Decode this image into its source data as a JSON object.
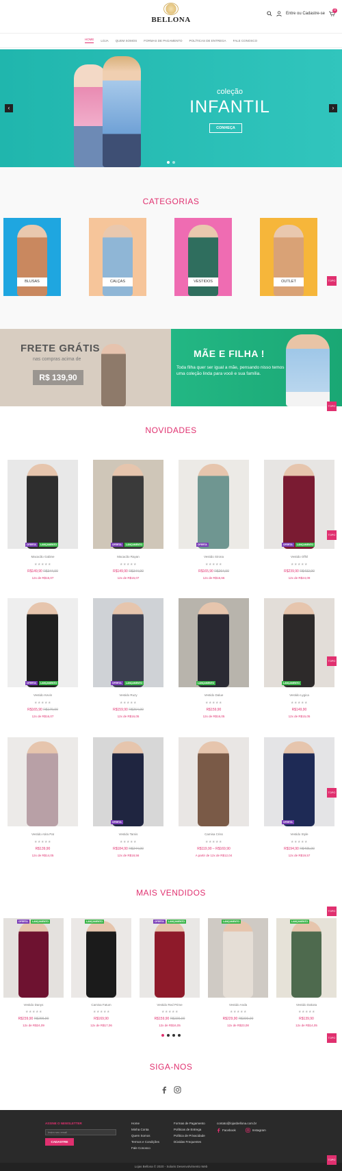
{
  "header": {
    "brand": "BELLONA",
    "account_label": "Entre ou Cadastre-se",
    "cart_count": "0"
  },
  "nav": [
    "HOME",
    "LOJA",
    "QUEM SOMOS",
    "FORMAS DE PAGAMENTO",
    "POLÍTICAS DE ENTREGA",
    "FALE CONOSCO"
  ],
  "hero": {
    "subtitle": "coleção",
    "title": "INFANTIL",
    "button": "CONHEÇA",
    "prev": "‹",
    "next": "›"
  },
  "categories": {
    "title": "CATEGORIAS",
    "items": [
      {
        "label": "BLUSAS",
        "bg": "#1fa6e0",
        "fig": "#c9885f"
      },
      {
        "label": "CALÇAS",
        "bg": "#f6c59a",
        "fig": "#8fb6d6"
      },
      {
        "label": "VESTIDOS",
        "bg": "#ef6cb2",
        "fig": "#2f6e5e"
      },
      {
        "label": "OUTLET",
        "bg": "#f6b63a",
        "fig": "#d9a276"
      }
    ]
  },
  "topo_label": "TOPO",
  "banners": {
    "frete_title": "FRETE GRÁTIS",
    "frete_sub": "nas compras acima de",
    "frete_price": "R$ 139,90",
    "mae_title": "MÃE E FILHA !",
    "mae_text": "Toda filha quer ser igual a mãe, pensando nisso temos uma coleção linda para você e sua família."
  },
  "novidades": {
    "title": "NOVIDADES",
    "products": [
      {
        "name": "Macacão Gabine",
        "price": "R$149,90",
        "old": "R$344,90",
        "inst": "12x de R$15,07",
        "tags": [
          "OFERTA",
          "LANÇAMENTO"
        ],
        "bg": "#e8e8e8",
        "fig": "#2e2e2e"
      },
      {
        "name": "Macacão Rayan",
        "price": "R$149,90",
        "old": "R$344,90",
        "inst": "12x de R$15,07",
        "tags": [
          "OFERTA",
          "LANÇAMENTO"
        ],
        "bg": "#cfc6b8",
        "fig": "#3a3a3a"
      },
      {
        "name": "Vestido Sirona",
        "price": "R$165,90",
        "old": "R$264,90",
        "inst": "12x de R$16,66",
        "tags": [
          "OFERTA"
        ],
        "bg": "#eceae6",
        "fig": "#6f9691"
      },
      {
        "name": "Vestido Ofhil",
        "price": "R$239,90",
        "old": "R$432,90",
        "inst": "12x de R$24,09",
        "tags": [
          "OFERTA",
          "LANÇAMENTO"
        ],
        "bg": "#e7e5e3",
        "fig": "#7a1b32"
      },
      {
        "name": "Vestido Kevin",
        "price": "R$165,90",
        "old": "R$179,90",
        "inst": "12x de R$16,07",
        "tags": [
          "OFERTA",
          "LANÇAMENTO"
        ],
        "bg": "#eeeeee",
        "fig": "#1f1f1f"
      },
      {
        "name": "Vestido Ruzy",
        "price": "R$159,90",
        "old": "R$264,90",
        "inst": "12x de R$16,05",
        "tags": [
          "OFERTA",
          "LANÇAMENTO"
        ],
        "bg": "#cfd2d6",
        "fig": "#3b3f4f"
      },
      {
        "name": "Vestido Dalue",
        "price": "R$159,90",
        "old": "",
        "inst": "12x de R$16,05",
        "tags": [
          "LANÇAMENTO"
        ],
        "bg": "#b8b4ac",
        "fig": "#2a2a33"
      },
      {
        "name": "Vestido Lygica",
        "price": "R$149,90",
        "old": "",
        "inst": "12x de R$15,05",
        "tags": [
          "LANÇAMENTO"
        ],
        "bg": "#e2ddd8",
        "fig": "#2d2a2a"
      },
      {
        "name": "Vestido Atira Pat",
        "price": "R$139,90",
        "old": "",
        "inst": "12x de R$14,05",
        "tags": [],
        "bg": "#eceae8",
        "fig": "#b8a0a6"
      },
      {
        "name": "Vestido Tamis",
        "price": "R$184,90",
        "old": "R$244,90",
        "inst": "12x de R$18,56",
        "tags": [
          "OFERTA"
        ],
        "bg": "#d7d7d7",
        "fig": "#1f2540"
      },
      {
        "name": "Camisa Criss",
        "price": "R$119,90 – R$169,90",
        "old": "",
        "inst": "A partir de 12x de R$12,04",
        "tags": [],
        "bg": "#e9e6e4",
        "fig": "#7a5a47"
      },
      {
        "name": "Vestido Style",
        "price": "R$194,90",
        "old": "R$405,90",
        "inst": "12x de R$19,57",
        "tags": [
          "OFERTA"
        ],
        "bg": "#e4e4e6",
        "fig": "#1e2a55"
      }
    ]
  },
  "mais_vendidos": {
    "title": "MAIS VENDIDOS",
    "products": [
      {
        "name": "Vestido Danys",
        "price": "R$239,90",
        "old": "R$299,90",
        "inst": "12x de R$24,09",
        "tags": [
          "OFERTA",
          "LANÇAMENTO"
        ],
        "bg": "#e4e1de",
        "fig": "#6e1230"
      },
      {
        "name": "Camisa Fatum",
        "price": "R$169,90",
        "old": "",
        "inst": "12x de R$17,06",
        "tags": [
          "LANÇAMENTO"
        ],
        "bg": "#ebe8e6",
        "fig": "#1b1b1b"
      },
      {
        "name": "Vestido Red Prime",
        "price": "R$159,90",
        "old": "R$220,00",
        "inst": "12x de R$16,05",
        "tags": [
          "OFERTA",
          "LANÇAMENTO"
        ],
        "bg": "#e9e7e5",
        "fig": "#8e1a2a"
      },
      {
        "name": "Vestido Anda",
        "price": "R$229,90",
        "old": "R$300,00",
        "inst": "12x de R$23,08",
        "tags": [
          "LANÇAMENTO"
        ],
        "bg": "#cfcac4",
        "fig": "#e5ded6"
      },
      {
        "name": "Vestido Dakota",
        "price": "R$139,90",
        "old": "",
        "inst": "12x de R$14,05",
        "tags": [
          "LANÇAMENTO"
        ],
        "bg": "#e6e2d8",
        "fig": "#4e6a4e"
      }
    ]
  },
  "stars": "★★★★★",
  "siga": {
    "title": "SIGA-NOS"
  },
  "footer": {
    "newsletter_title": "ASSINE O NEWSLETTER",
    "newsletter_placeholder": "Insira seu email",
    "newsletter_button": "CADASTRE",
    "col1": [
      "Home",
      "Minha Conta",
      "Quem Somos",
      "Termos e Condições",
      "Fale Conosco"
    ],
    "col2": [
      "Formas de Pagamento",
      "Políticas de Entrega",
      "Política de Privacidade",
      "Dúvidas Frequentes"
    ],
    "email": "contato@lojasbellona.com.br",
    "facebook": "Facebook",
    "instagram": "Instagram",
    "copyright": "Lojas Bellona © 2020 - Solaris Desenvolvimento Web"
  }
}
